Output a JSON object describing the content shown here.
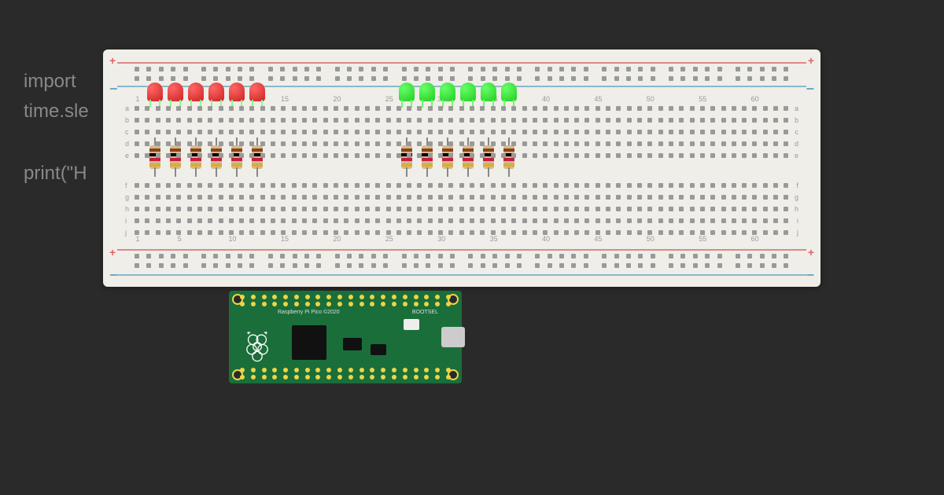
{
  "code": {
    "line1": "import",
    "line2": "time.sle",
    "line3": "print(\"H"
  },
  "board": {
    "label": "Raspberry Pi Pico ©2020",
    "button_label": "BOOTSEL"
  },
  "breadboard": {
    "col_markers": [
      "1",
      "5",
      "10",
      "15",
      "20",
      "25",
      "30",
      "35",
      "40",
      "45",
      "50",
      "55",
      "60"
    ],
    "row_labels_top": [
      "a",
      "b",
      "c",
      "d",
      "e"
    ],
    "row_labels_bottom": [
      "f",
      "g",
      "h",
      "i",
      "j"
    ]
  },
  "components": {
    "red_leds": 6,
    "green_leds": 6,
    "resistors": 12,
    "resistor_bands": [
      "#8b4513",
      "#000",
      "#c41e3a",
      "#d4af37"
    ]
  }
}
